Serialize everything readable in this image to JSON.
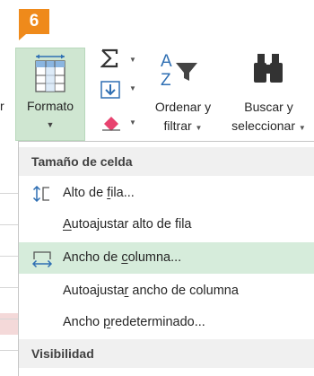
{
  "badge": {
    "step": "6"
  },
  "ribbon": {
    "format_label": "Formato",
    "left_cut_label": "r",
    "sort": {
      "line1": "Ordenar y",
      "line2": "filtrar"
    },
    "find": {
      "line1": "Buscar y",
      "line2": "seleccionar"
    }
  },
  "menu": {
    "section1": "Tamaño de celda",
    "items": [
      {
        "pre": "Alto de ",
        "u": "f",
        "post": "ila..."
      },
      {
        "pre": "",
        "u": "A",
        "post": "utoajustar alto de fila"
      },
      {
        "pre": "Ancho de ",
        "u": "c",
        "post": "olumna..."
      },
      {
        "pre": "Autoajusta",
        "u": "r",
        "post": " ancho de columna"
      },
      {
        "pre": "Ancho ",
        "u": "p",
        "post": "redeterminado..."
      }
    ],
    "section2": "Visibilidad"
  },
  "colors": {
    "badge": "#ef8a1b",
    "highlight": "#d6ecdb",
    "accent_green": "#217346"
  }
}
